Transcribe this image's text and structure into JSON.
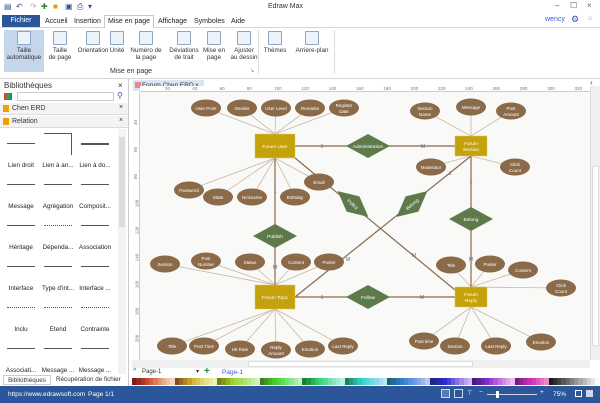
{
  "app_title": "Edraw Max",
  "user": "wency",
  "tabs": {
    "file": "Fichier",
    "items": [
      "Accueil",
      "Insertion",
      "Mise en page",
      "Affichage",
      "Symboles",
      "Aide"
    ],
    "active": "Mise en page"
  },
  "ribbon": {
    "buttons": [
      {
        "l1": "Taille",
        "l2": "automatique"
      },
      {
        "l1": "Taille",
        "l2": "de page"
      },
      {
        "l1": "Orientation",
        "l2": ""
      },
      {
        "l1": "Unité",
        "l2": ""
      },
      {
        "l1": "Numéro de",
        "l2": "la page"
      },
      {
        "l1": "Déviations",
        "l2": "de trait"
      },
      {
        "l1": "Mise en",
        "l2": "page"
      },
      {
        "l1": "Ajuster",
        "l2": "au dessin"
      },
      {
        "l1": "Thèmes",
        "l2": ""
      },
      {
        "l1": "Arrière-plan",
        "l2": ""
      }
    ],
    "group_label": "Mise en page"
  },
  "library": {
    "title": "Bibliothèques",
    "search_value": "",
    "sections": [
      "Chen ERD",
      "Relation"
    ],
    "shapes": [
      "Lien droit",
      "Lien à an...",
      "Lien à do...",
      "Message",
      "Agrégation",
      "Composit...",
      "Héritage",
      "Dépenda...",
      "Association",
      "Interface",
      "Type d'int...",
      "Interface ...",
      "Inclu",
      "Étend",
      "Contrainte",
      "Associati...",
      "Message ...",
      "Message ..."
    ],
    "bottom_tabs": [
      "Bibliothèques",
      "Récupération de fichier"
    ]
  },
  "document_tab": "Forum Chen ERD",
  "ruler": {
    "top": [
      "20",
      "40",
      "60",
      "80",
      "100",
      "120",
      "140",
      "160",
      "180",
      "200",
      "220",
      "240",
      "260",
      "280",
      "300",
      "320"
    ],
    "left": [
      "40",
      "60",
      "80",
      "100",
      "120",
      "140",
      "160",
      "180",
      "200"
    ]
  },
  "diagram": {
    "entities": [
      "Forum User",
      "Forum Section",
      "Forum Topic",
      "Forum Reply"
    ],
    "relationships": [
      "Administration",
      "Publish",
      "Follow",
      "Belong",
      "Policy",
      "Belong"
    ],
    "attributes": [
      "User Point",
      "Gender",
      "User Level",
      "Remarks",
      "Register Date",
      "Password",
      "State",
      "Nickname",
      "Birthday",
      "Email",
      "Section Name",
      "Message",
      "Post Amount",
      "Moderator",
      "Click Count",
      "Section",
      "Post Number",
      "Status",
      "Content",
      "Poster",
      "Title",
      "Post Time",
      "Hit Rate",
      "Reply Amount",
      "Emotion",
      "Last Reply",
      "Title",
      "Poster",
      "Content",
      "Click Count",
      "Post time",
      "Section",
      "Last Reply",
      "Emotion"
    ],
    "cardinalities": [
      "1",
      "M",
      "1",
      "M",
      "M",
      "1",
      "1",
      "M",
      "M",
      "1",
      "M"
    ],
    "colors": {
      "entity": "#c4a20c",
      "relationship": "#5f7a4a",
      "attribute": "#8b6a4a",
      "line": "#c9b8a4"
    }
  },
  "pages": {
    "selector": "Page-1",
    "active": "Page-1",
    "add": "+"
  },
  "status": {
    "url": "https://www.edrawsoft.com",
    "page": "Page 1/1",
    "zoom": "75%"
  }
}
